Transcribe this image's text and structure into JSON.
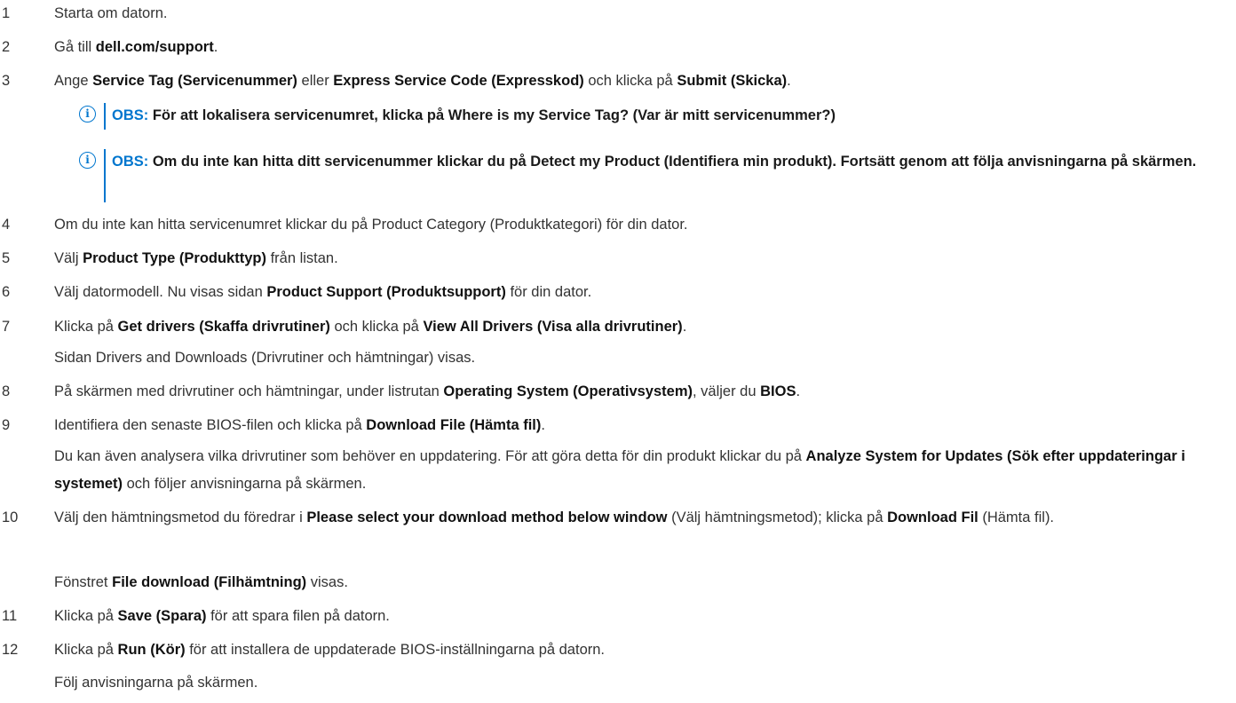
{
  "steps": [
    {
      "num": "1",
      "parts": [
        {
          "t": "Starta om datorn."
        }
      ]
    },
    {
      "num": "2",
      "parts": [
        {
          "t": "Gå till "
        },
        {
          "t": "dell.com/support",
          "b": true
        },
        {
          "t": "."
        }
      ]
    },
    {
      "num": "3",
      "parts": [
        {
          "t": "Ange "
        },
        {
          "t": "Service Tag (Servicenummer)",
          "b": true
        },
        {
          "t": " eller "
        },
        {
          "t": "Express Service Code (Expresskod)",
          "b": true
        },
        {
          "t": " och klicka på "
        },
        {
          "t": "Submit (Skicka)",
          "b": true
        },
        {
          "t": "."
        }
      ]
    },
    {
      "num": "4",
      "parts": [
        {
          "t": "Om du inte kan hitta servicenumret klickar du på Product Category (Produktkategori) för din dator."
        }
      ]
    },
    {
      "num": "5",
      "parts": [
        {
          "t": "Välj "
        },
        {
          "t": "Product Type (Produkttyp)",
          "b": true
        },
        {
          "t": " från listan."
        }
      ]
    },
    {
      "num": "6",
      "parts": [
        {
          "t": "Välj datormodell. Nu visas sidan "
        },
        {
          "t": "Product Support (Produktsupport)",
          "b": true
        },
        {
          "t": " för din dator."
        }
      ]
    },
    {
      "num": "7",
      "parts": [
        {
          "t": "Klicka på "
        },
        {
          "t": "Get drivers (Skaffa drivrutiner)",
          "b": true
        },
        {
          "t": " och klicka på "
        },
        {
          "t": "View All Drivers (Visa alla drivrutiner)",
          "b": true
        },
        {
          "t": "."
        }
      ]
    },
    {
      "num": "8",
      "parts": [
        {
          "t": "På skärmen med drivrutiner och hämtningar, under listrutan "
        },
        {
          "t": "Operating System (Operativsystem)",
          "b": true
        },
        {
          "t": ", väljer du "
        },
        {
          "t": "BIOS",
          "b": true
        },
        {
          "t": "."
        }
      ]
    },
    {
      "num": "9",
      "parts": [
        {
          "t": "Identifiera den senaste BIOS-filen och klicka på "
        },
        {
          "t": "Download File (Hämta fil)",
          "b": true
        },
        {
          "t": "."
        }
      ]
    },
    {
      "num": "10",
      "parts": [
        {
          "t": "Välj den hämtningsmetod du föredrar i "
        },
        {
          "t": "Please select your download method below window",
          "b": true
        },
        {
          "t": " (Välj hämtningsmetod); klicka på "
        },
        {
          "t": "Download Fil",
          "b": true
        },
        {
          "t": " (Hämta fil)."
        }
      ]
    },
    {
      "num": "11",
      "parts": [
        {
          "t": "Klicka på "
        },
        {
          "t": "Save (Spara)",
          "b": true
        },
        {
          "t": " för att spara filen på datorn."
        }
      ]
    },
    {
      "num": "12",
      "parts": [
        {
          "t": "Klicka på "
        },
        {
          "t": "Run (Kör)",
          "b": true
        },
        {
          "t": " för att installera de uppdaterade BIOS-inställningarna på datorn."
        }
      ]
    }
  ],
  "notes": [
    {
      "label": "OBS:",
      "text": " För att lokalisera servicenumret, klicka på Where is my Service Tag? (Var är mitt servicenummer?)"
    },
    {
      "label": "OBS:",
      "text": " Om du inte kan hitta ditt servicenummer klickar du på Detect my Product (Identifiera min produkt). Fortsätt genom att följa anvisningarna på skärmen."
    }
  ],
  "paras": {
    "after7": [
      {
        "t": "Sidan Drivers and Downloads (Drivrutiner och hämtningar) visas."
      }
    ],
    "after9": [
      {
        "t": "Du kan även analysera vilka drivrutiner som behöver en uppdatering. För att göra detta för din produkt klickar du på "
      },
      {
        "t": "Analyze System for Updates (Sök efter uppdateringar i systemet)",
        "b": true
      },
      {
        "t": " och följer anvisningarna på skärmen."
      }
    ],
    "after10": [
      {
        "t": "Fönstret "
      },
      {
        "t": "File download (Filhämtning)",
        "b": true
      },
      {
        "t": " visas."
      }
    ],
    "after12": [
      {
        "t": "Följ anvisningarna på skärmen."
      }
    ]
  },
  "icons": {
    "note": "info-circle-icon"
  },
  "colors": {
    "accent": "#0076ce",
    "text": "#333333"
  }
}
